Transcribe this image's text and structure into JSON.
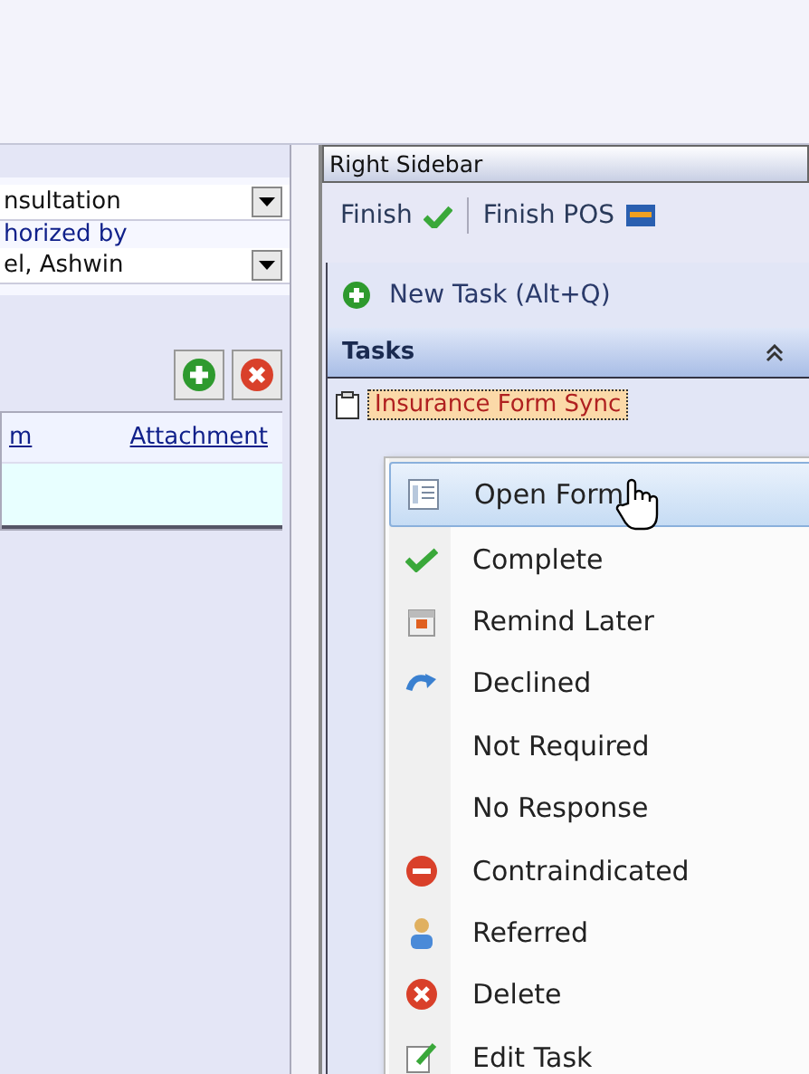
{
  "left_panel": {
    "combo_1": {
      "value": "nsultation"
    },
    "authorized_label": "horized by",
    "combo_2": {
      "value": "el, Ashwin"
    },
    "table": {
      "columns": [
        "m",
        "Attachment"
      ]
    }
  },
  "right_sidebar": {
    "title": "Right Sidebar",
    "toolbar": [
      {
        "label": "Finish",
        "kind": "check"
      },
      {
        "label": "Finish POS",
        "kind": "pos"
      }
    ],
    "new_task": "New Task (Alt+Q)",
    "section": {
      "title": "Tasks",
      "expanded": true
    },
    "tasks": [
      {
        "label": "Insurance Form Sync"
      }
    ]
  },
  "context_menu": [
    {
      "label": "Open Form",
      "kind": "form",
      "selected": true
    },
    {
      "label": "Complete",
      "kind": "check",
      "selected": false
    },
    {
      "label": "Remind Later",
      "kind": "calendar",
      "selected": false
    },
    {
      "label": "Declined",
      "kind": "curve",
      "selected": false
    },
    {
      "label": "Not Required",
      "kind": "plain",
      "selected": false
    },
    {
      "label": "No Response",
      "kind": "plain",
      "selected": false
    },
    {
      "label": "Contraindicated",
      "kind": "minus",
      "selected": false
    },
    {
      "label": "Referred",
      "kind": "person",
      "selected": false
    },
    {
      "label": "Delete",
      "kind": "x",
      "selected": false
    },
    {
      "label": "Edit Task",
      "kind": "edit",
      "selected": false
    }
  ]
}
